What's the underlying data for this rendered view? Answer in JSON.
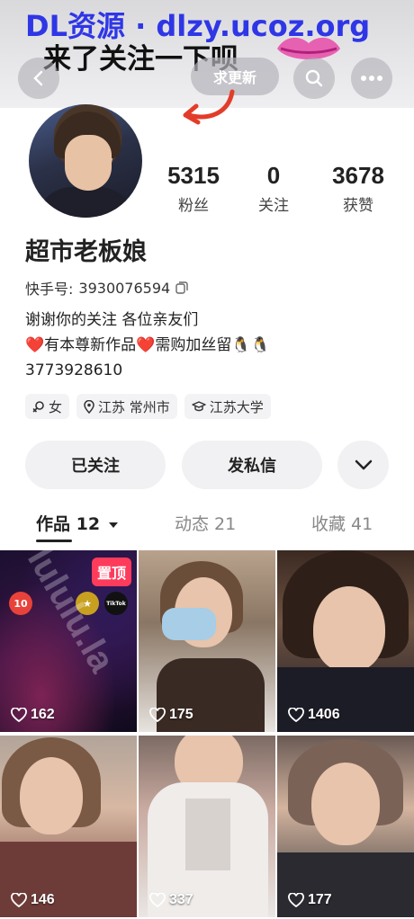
{
  "watermark": {
    "top": "DL资源 · dlzy.ucoz.org",
    "diagonal": "lululu.la"
  },
  "header": {
    "caption": "来了关注一下呗",
    "update_button": "求更新",
    "back_icon": "chevron-left-icon",
    "search_icon": "search-icon",
    "more_icon": "more-dots-icon"
  },
  "profile": {
    "nickname": "超市老板娘",
    "id_label": "快手号:",
    "id_value": "3930076594",
    "bio": "谢谢你的关注 各位亲友们\n❤️有本尊新作品❤️需购加丝留🐧🐧\n3773928610",
    "stats": {
      "fans": {
        "value": "5315",
        "label": "粉丝"
      },
      "following": {
        "value": "0",
        "label": "关注"
      },
      "likes": {
        "value": "3678",
        "label": "获赞"
      }
    },
    "tags": [
      {
        "icon": "female-icon",
        "label": "女"
      },
      {
        "icon": "location-icon",
        "label": "江苏 常州市"
      },
      {
        "icon": "graduation-cap-icon",
        "label": "江苏大学"
      }
    ]
  },
  "actions": {
    "followed": "已关注",
    "message": "发私信",
    "dropdown_icon": "chevron-down-icon"
  },
  "tabs": [
    {
      "label": "作品 12",
      "active": true
    },
    {
      "label": "动态 21",
      "active": false
    },
    {
      "label": "收藏 41",
      "active": false
    }
  ],
  "grid": [
    {
      "likes": "162",
      "pinned": true,
      "pin_label": "置顶"
    },
    {
      "likes": "175",
      "pinned": false
    },
    {
      "likes": "1406",
      "pinned": false
    },
    {
      "likes": "146",
      "pinned": false
    },
    {
      "likes": "337",
      "pinned": false
    },
    {
      "likes": "177",
      "pinned": false
    }
  ],
  "first_video_apps": [
    {
      "label": "10",
      "color": "#e8423a"
    },
    {
      "label": "★",
      "color": "#c8a020"
    },
    {
      "label": "TikTok",
      "color": "#111111"
    }
  ]
}
